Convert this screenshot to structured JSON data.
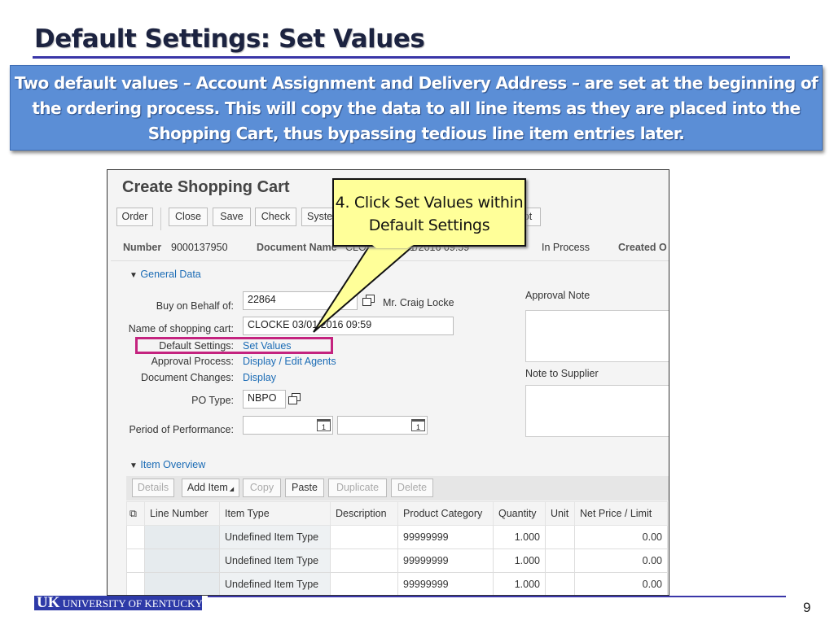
{
  "slide": {
    "title": "Default Settings: Set Values",
    "banner": "Two default values – Account Assignment and Delivery Address – are set at the beginning of the ordering process. This will copy the data to all line items as they are placed into the Shopping Cart, thus bypassing tedious line item entries later.",
    "callout": "4. Click Set Values within Default Settings",
    "page_number": "9",
    "logo_text": "UNIVERSITY OF KENTUCKY",
    "logo_mark": "UK"
  },
  "app": {
    "title": "Create Shopping Cart",
    "toolbar": [
      "Order",
      "Close",
      "Save",
      "Check",
      "System",
      "pt"
    ],
    "header": {
      "number_label": "Number",
      "number": "9000137950",
      "docname_label": "Document Name",
      "docname": "CLOCKE 03/01/2016 09:59",
      "status": "In Process",
      "created_label": "Created O"
    },
    "general_data": "General Data",
    "fields": {
      "buy_label": "Buy on Behalf of:",
      "buy_value": "22864",
      "buy_name": "Mr. Craig Locke",
      "name_label": "Name of shopping cart:",
      "name_value": "CLOCKE 03/01/2016 09:59",
      "default_label": "Default Settings:",
      "default_link": "Set Values",
      "approval_label": "Approval Process:",
      "approval_link": "Display / Edit Agents",
      "changes_label": "Document Changes:",
      "changes_link": "Display",
      "po_label": "PO Type:",
      "po_value": "NBPO",
      "period_label": "Period of Performance:"
    },
    "approval_note": "Approval Note",
    "note_supplier": "Note to Supplier",
    "item_overview": "Item Overview",
    "item_toolbar": [
      "Details",
      "Add Item",
      "Copy",
      "Paste",
      "Duplicate",
      "Delete"
    ],
    "columns": [
      "Line Number",
      "Item Type",
      "Description",
      "Product Category",
      "Quantity",
      "Unit",
      "Net Price / Limit"
    ],
    "rows": [
      {
        "item_type": "Undefined Item Type",
        "category": "99999999",
        "quantity": "1.000",
        "price": "0.00"
      },
      {
        "item_type": "Undefined Item Type",
        "category": "99999999",
        "quantity": "1.000",
        "price": "0.00"
      },
      {
        "item_type": "Undefined Item Type",
        "category": "99999999",
        "quantity": "1.000",
        "price": "0.00"
      }
    ]
  },
  "colors": {
    "banner": "#5b8ed6",
    "rule": "#3a36a8",
    "callout": "#ffff99",
    "highlight": "#c4237f",
    "link": "#1a6bb5"
  }
}
